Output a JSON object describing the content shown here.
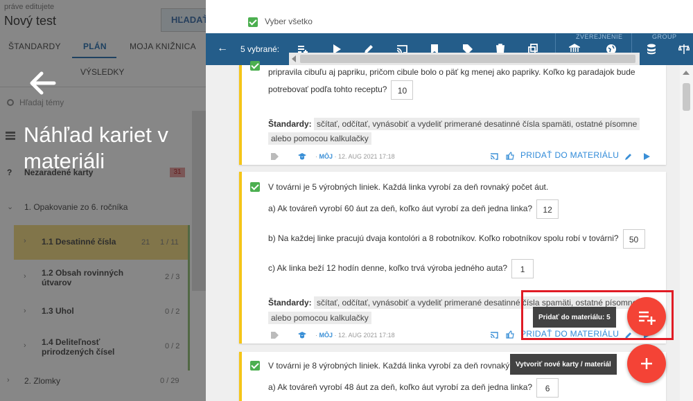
{
  "left": {
    "editing_label": "práve editujete",
    "doc_title": "Nový test",
    "search_button": "HĽADAŤ",
    "tabs": [
      "ŠTANDARDY",
      "PLÁN",
      "MOJA KNIŽNICA"
    ],
    "tab_results": "VÝSLEDKY",
    "search_placeholder": "Hľadaj témy",
    "tree": {
      "unsorted": {
        "label": "Nezaradené karty",
        "count": "31"
      },
      "chapter1": "1. Opakovanie zo 6. ročníka",
      "items": [
        {
          "label": "1.1 Desatinné čísla",
          "count_a": "21",
          "count_b": "1 / 11"
        },
        {
          "label": "1.2 Obsah rovinných útvarov",
          "count_b": "2 / 3"
        },
        {
          "label": "1.3 Uhol",
          "count_b": "0 / 2"
        },
        {
          "label": "1.4 Deliteľnosť prirodzených čísel",
          "count_b": "0 / 2"
        }
      ],
      "chapter2": {
        "label": "2. Zlomky",
        "count": "0 / 29"
      }
    }
  },
  "overlay": {
    "title": "Náhľad kariet v materiáli"
  },
  "right": {
    "select_all": "Vyber všetko",
    "toolbar": {
      "selected": "5 vybrané:",
      "group_published": "ZVEREJNENIE",
      "group_group": "GROUP"
    },
    "cards": [
      {
        "line1": "pripravila cibuľu aj papriku, pričom cibule bolo o päť kg menej ako papriky. Koľko kg paradajok bude",
        "line2": "potrebovať podľa tohto receptu?",
        "answer": "10",
        "std_label": "Štandardy:",
        "std_line1": "sčítať, odčítať, vynásobiť a vydeliť primerané desatinné čísla spamäti, ostatné písomne",
        "std_line2": "alebo pomocou kalkulačky",
        "owner": "MÔJ",
        "date": "12. AUG 2021 17:18",
        "add_label": "PRIDAŤ DO MATERIÁLU"
      },
      {
        "intro": "V továrni je 5 výrobných liniek. Každá linka vyrobí za deň rovnaký počet áut.",
        "qa": "a) Ak továreň vyrobí 60 áut za deň, koľko áut vyrobí za deň jedna linka?",
        "qa_answer": "12",
        "qb": "b) Na každej linke pracujú dvaja kontolóri a 8 robotníkov. Koľko robotníkov spolu robí v továrni?",
        "qb_answer": "50",
        "qc": "c) Ak linka beží 12 hodín denne, koľko trvá výroba jedného auta?",
        "qc_answer": "1",
        "std_label": "Štandardy:",
        "std_line1": "sčítať, odčítať, vynásobiť a vydeliť primerané desatinné čísla spamäti, ostatné písomne",
        "std_line2": "alebo pomocou kalkulačky",
        "owner": "MÔJ",
        "date": "12. AUG 2021 17:18",
        "add_label": "PRIDAŤ DO MATERIÁLU"
      },
      {
        "intro": "V továrni je 8 výrobných liniek. Každá linka vyrobí za deň rovnaký počet áut.",
        "qa": "a) Ak továreň vyrobí 48 áut za deň, koľko áut vyrobí za deň jedna linka?",
        "qa_answer": "6"
      }
    ],
    "fab_add_tooltip": "Pridať do materiálu: 5",
    "fab_new_tooltip": "Vytvoriť nové karty / materiál"
  },
  "colors": {
    "toolbar": "#245d8a",
    "accent_blue": "#2f8ad8",
    "card_border": "#f5c518",
    "check_green": "#4caf50",
    "fab_red": "#f44336",
    "highlight_red": "#e01b24"
  }
}
